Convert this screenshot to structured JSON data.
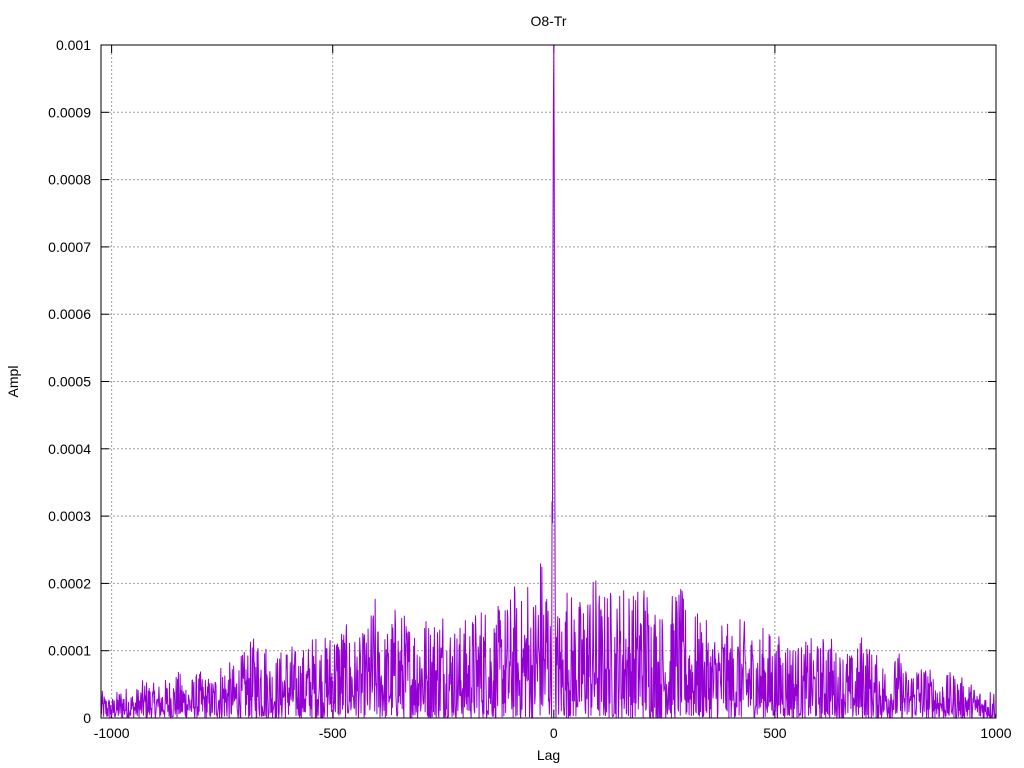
{
  "chart_data": {
    "type": "line",
    "title": "O8-Tr",
    "xlabel": "Lag",
    "ylabel": "Ampl",
    "xlim": [
      -1024,
      1000
    ],
    "ylim": [
      0,
      0.001
    ],
    "x_ticks": [
      -1000,
      -500,
      0,
      500,
      1000
    ],
    "y_ticks": [
      0,
      0.0001,
      0.0002,
      0.0003,
      0.0004,
      0.0005,
      0.0006,
      0.0007,
      0.0008,
      0.0009,
      0.001
    ],
    "x_tick_labels": [
      "-1000",
      "-500",
      "0",
      "500",
      "1000"
    ],
    "y_tick_labels": [
      "0",
      "0.0001",
      "0.0002",
      "0.0003",
      "0.0004",
      "0.0005",
      "0.0006",
      "0.0007",
      "0.0008",
      "0.0009",
      "0.001"
    ],
    "grid": true,
    "legend": "none",
    "series_color": "#9400d3",
    "series": [
      {
        "x": [
          -1020,
          -1000,
          -975,
          -950,
          -925,
          -900,
          -875,
          -850,
          -825,
          -800,
          -775,
          -750,
          -725,
          -700,
          -680,
          -660,
          -640,
          -620,
          -600,
          -580,
          -560,
          -540,
          -520,
          -500,
          -480,
          -460,
          -440,
          -420,
          -405,
          -400,
          -380,
          -360,
          -340,
          -320,
          -300,
          -280,
          -260,
          -250,
          -240,
          -220,
          -200,
          -180,
          -160,
          -140,
          -120,
          -100,
          -90,
          -80,
          -70,
          -60,
          -50,
          -40,
          -30,
          -20,
          -15,
          -10,
          -8,
          -5,
          -3,
          -2,
          -1,
          0,
          1,
          2,
          3,
          5,
          10,
          20,
          30,
          40,
          60,
          80,
          100,
          110,
          120,
          140,
          160,
          180,
          200,
          220,
          240,
          260,
          280,
          300,
          320,
          340,
          360,
          380,
          400,
          420,
          440,
          460,
          480,
          500,
          520,
          540,
          560,
          580,
          600,
          620,
          640,
          660,
          680,
          700,
          720,
          740,
          760,
          780,
          800,
          820,
          840,
          860,
          880,
          900,
          925,
          950,
          975,
          1000
        ],
        "y": [
          4e-05,
          3e-05,
          5e-05,
          4e-05,
          6e-05,
          5e-05,
          6e-05,
          7e-05,
          6e-05,
          7e-05,
          6e-05,
          9e-05,
          8e-05,
          0.0001,
          0.00012,
          0.00014,
          9e-05,
          0.0001,
          0.00012,
          0.0001,
          0.00011,
          0.00013,
          0.00012,
          0.00014,
          0.00015,
          0.00013,
          0.00012,
          0.00014,
          0.00019,
          0.00015,
          0.00013,
          0.00017,
          0.00016,
          0.00015,
          0.00017,
          0.00015,
          0.00017,
          0.00018,
          0.00016,
          0.00014,
          0.00015,
          0.00016,
          0.00018,
          0.00016,
          0.00017,
          0.00018,
          0.00021,
          0.00016,
          0.00019,
          0.00023,
          0.00017,
          0.00022,
          0.00026,
          0.00021,
          0.00027,
          0.00019,
          0.00016,
          0.00043,
          0.00029,
          0.00068,
          0.0009,
          0.001,
          0.00082,
          0.00043,
          0.00021,
          0.00015,
          0.00018,
          0.00016,
          0.00021,
          0.00019,
          0.00018,
          0.00021,
          0.00022,
          0.00017,
          0.00021,
          0.00018,
          0.00022,
          0.00019,
          0.00022,
          0.0002,
          0.00016,
          0.00017,
          0.00021,
          0.00017,
          0.00016,
          0.00015,
          0.00013,
          0.00016,
          0.00013,
          0.00015,
          0.00014,
          0.00013,
          0.00014,
          0.00012,
          0.00013,
          0.00012,
          0.00011,
          0.00012,
          0.00011,
          0.00014,
          0.0001,
          0.00011,
          9e-05,
          0.00014,
          0.0001,
          9e-05,
          8e-05,
          0.0001,
          7e-05,
          9e-05,
          8e-05,
          7e-05,
          6e-05,
          7e-05,
          6e-05,
          5e-05,
          4e-05,
          5e-05
        ]
      }
    ]
  }
}
